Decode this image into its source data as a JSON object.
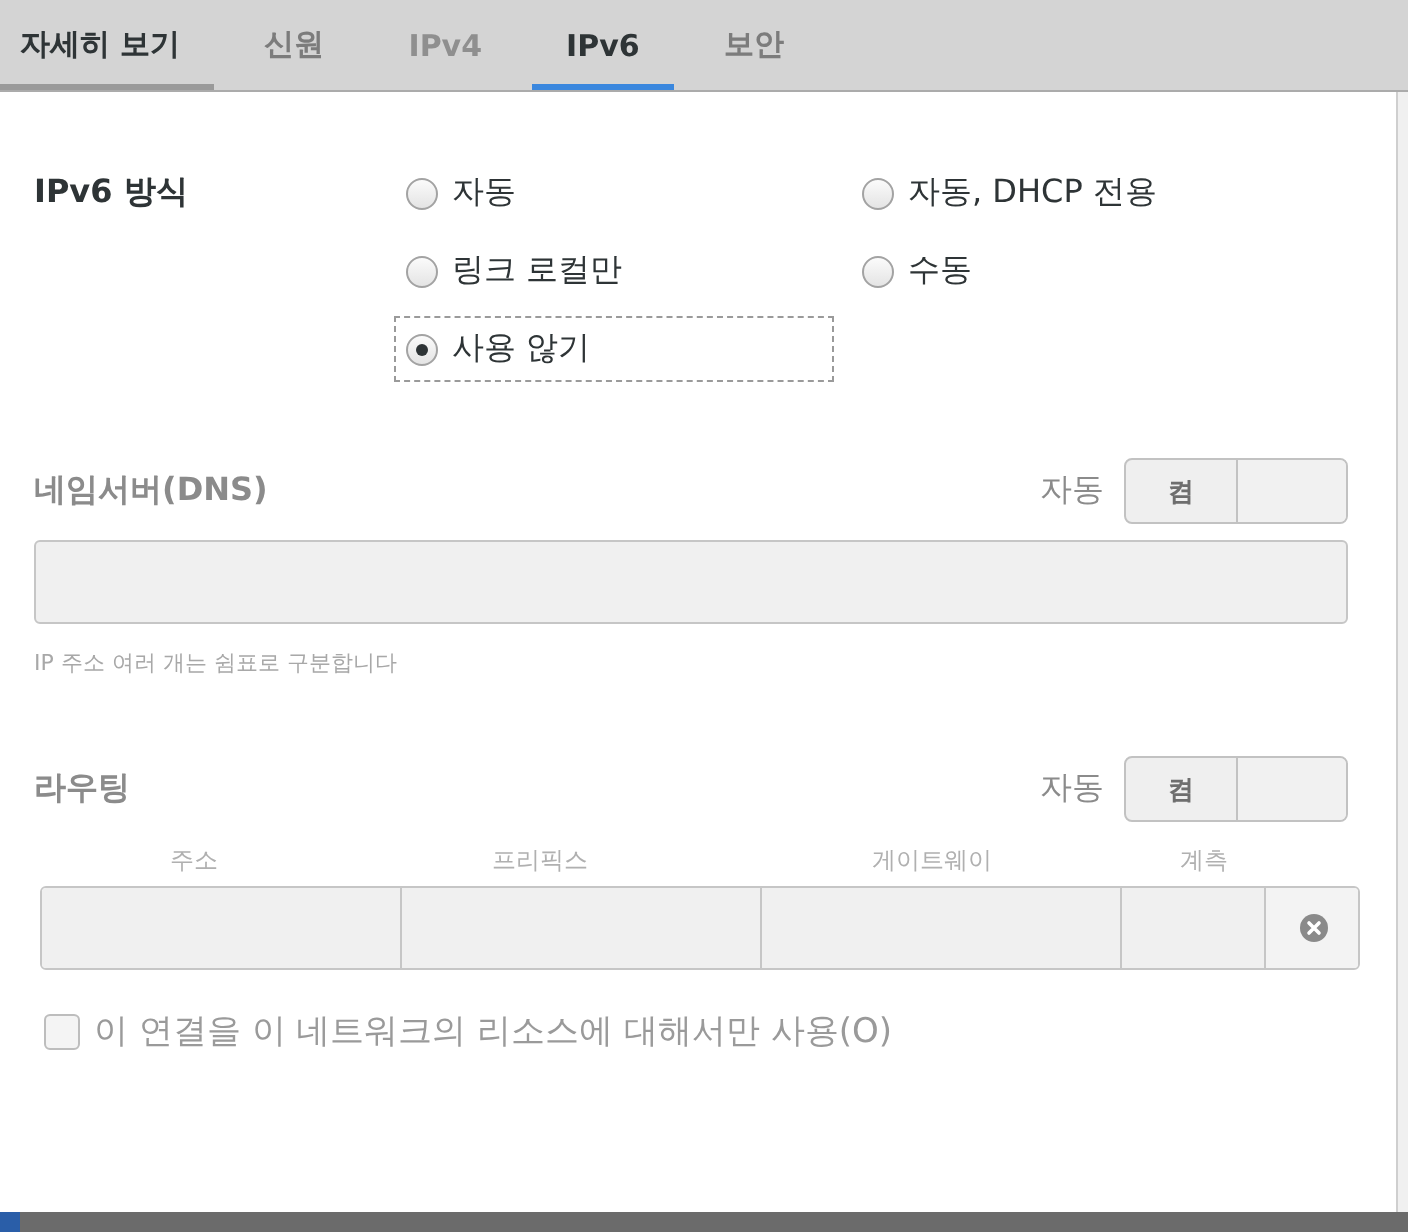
{
  "tabs": [
    {
      "label": "자세히 보기",
      "selected": false,
      "hovered": true,
      "disabled": false
    },
    {
      "label": "신원",
      "selected": false,
      "hovered": false,
      "disabled": false
    },
    {
      "label": "IPv4",
      "selected": false,
      "hovered": false,
      "disabled": true
    },
    {
      "label": "IPv6",
      "selected": true,
      "hovered": false,
      "disabled": false
    },
    {
      "label": "보안",
      "selected": false,
      "hovered": false,
      "disabled": false
    }
  ],
  "method": {
    "label": "IPv6 방식",
    "options": [
      {
        "label": "자동",
        "selected": false,
        "focused": false
      },
      {
        "label": "자동, DHCP 전용",
        "selected": false,
        "focused": false
      },
      {
        "label": "링크 로컬만",
        "selected": false,
        "focused": false
      },
      {
        "label": "수동",
        "selected": false,
        "focused": false
      },
      {
        "label": "사용 않기",
        "selected": true,
        "focused": true
      }
    ]
  },
  "dns": {
    "title": "네임서버(DNS)",
    "disabled": true,
    "auto_label": "자동",
    "switch": {
      "label": "켬",
      "on": true
    },
    "hint": "IP 주소 여러 개는 쉼표로 구분합니다"
  },
  "routes": {
    "title": "라우팅",
    "disabled": true,
    "auto_label": "자동",
    "switch": {
      "label": "켬",
      "on": true
    },
    "columns": [
      "주소",
      "프리픽스",
      "게이트웨이",
      "계측"
    ]
  },
  "checkbox": {
    "label": "이 연결을 이 네트워크의 리소스에 대해서만 사용(O)",
    "checked": false,
    "disabled": true
  }
}
